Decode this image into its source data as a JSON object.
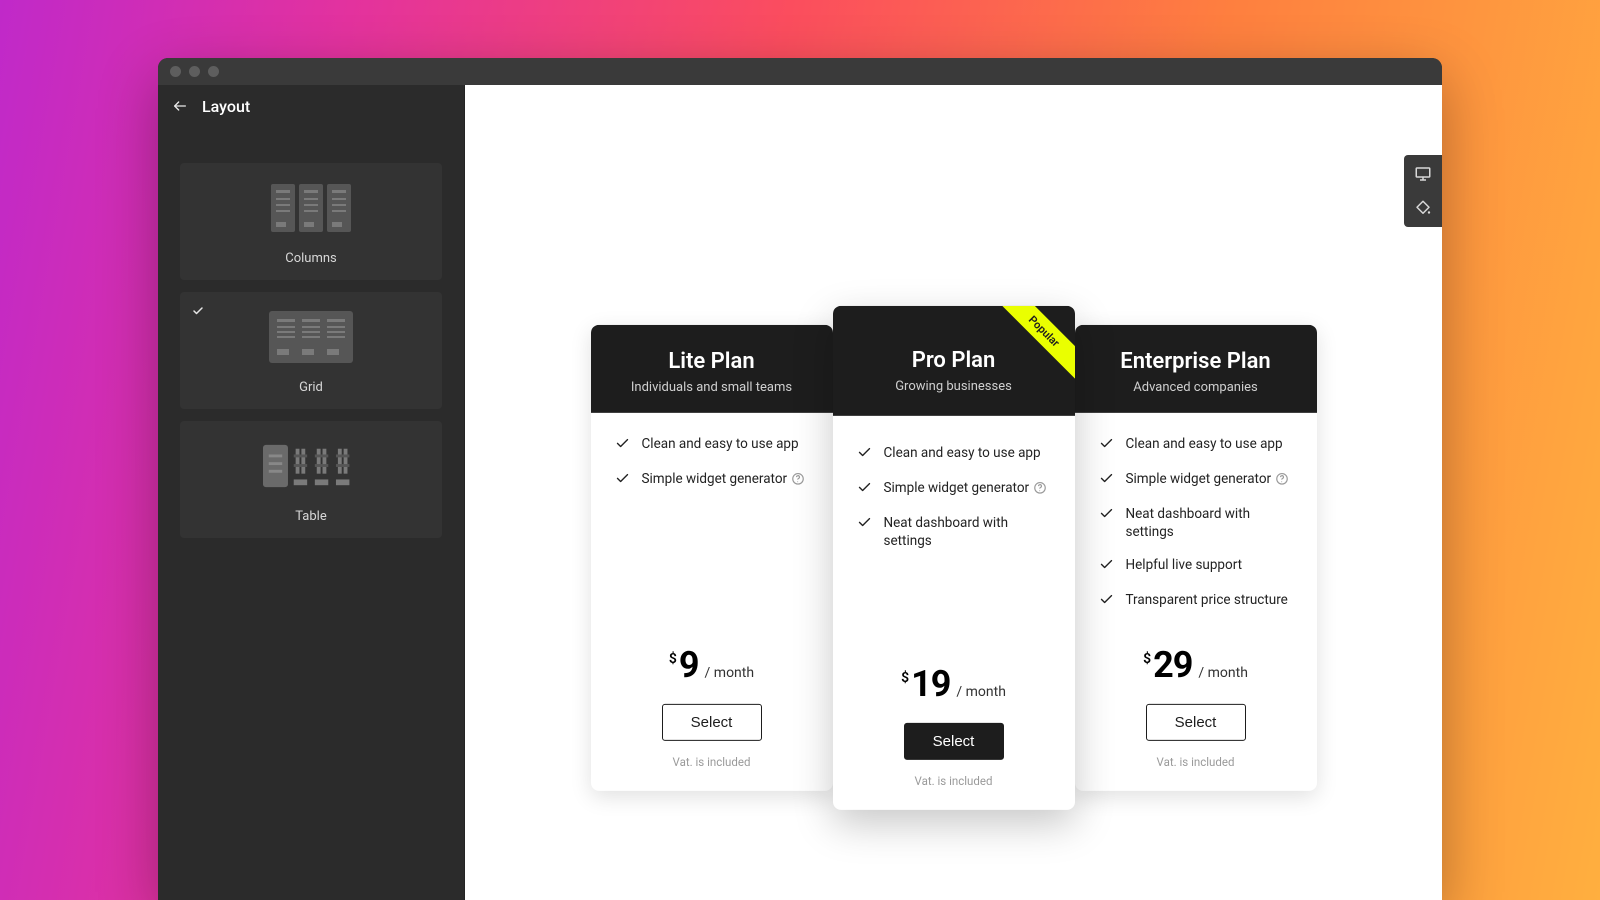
{
  "sidebar": {
    "title": "Layout",
    "options": [
      {
        "label": "Columns",
        "selected": false
      },
      {
        "label": "Grid",
        "selected": true
      },
      {
        "label": "Table",
        "selected": false
      }
    ]
  },
  "pricing": {
    "popular_badge": "Popular",
    "currency_symbol": "$",
    "period_label": "/ month",
    "select_label": "Select",
    "vat_note": "Vat. is included",
    "plans": [
      {
        "id": "lite",
        "title": "Lite Plan",
        "subtitle": "Individuals and small teams",
        "price": "9",
        "popular": false,
        "button_variant": "outline",
        "features": [
          {
            "text": "Clean and easy to use app",
            "help": false
          },
          {
            "text": "Simple widget generator",
            "help": true
          }
        ]
      },
      {
        "id": "pro",
        "title": "Pro Plan",
        "subtitle": "Growing businesses",
        "price": "19",
        "popular": true,
        "button_variant": "primary",
        "features": [
          {
            "text": "Clean and easy to use app",
            "help": false
          },
          {
            "text": "Simple widget generator",
            "help": true
          },
          {
            "text": "Neat dashboard with settings",
            "help": false
          }
        ]
      },
      {
        "id": "ent",
        "title": "Enterprise Plan",
        "subtitle": "Advanced companies",
        "price": "29",
        "popular": false,
        "button_variant": "outline",
        "features": [
          {
            "text": "Clean and easy to use app",
            "help": false
          },
          {
            "text": "Simple widget generator",
            "help": true
          },
          {
            "text": "Neat dashboard with settings",
            "help": false
          },
          {
            "text": "Helpful live support",
            "help": false
          },
          {
            "text": "Transparent price structure",
            "help": false
          }
        ]
      }
    ]
  }
}
